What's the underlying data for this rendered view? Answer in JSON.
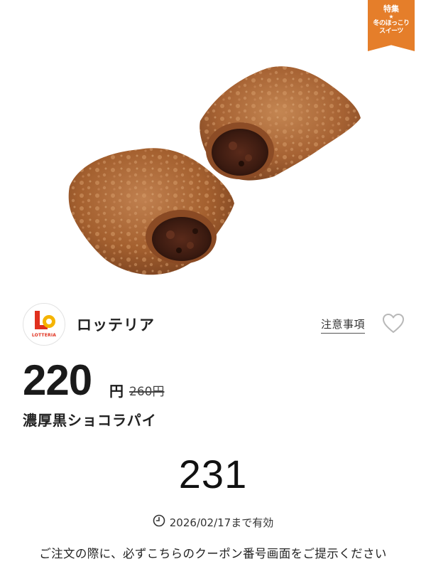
{
  "ribbon": {
    "title": "特集",
    "star": "★",
    "line1": "冬のほっこり",
    "line2": "スイーツ"
  },
  "hero": {
    "image": "chocolate-pie-photo"
  },
  "brand": {
    "logo_text": "LOTTERIA",
    "name": "ロッテリア",
    "notice_label": "注意事項",
    "favorite_icon": "heart-outline-icon"
  },
  "price": {
    "current": "220",
    "currency": "円",
    "original": "260円"
  },
  "product": {
    "name": "濃厚黒ショコラパイ"
  },
  "coupon": {
    "number": "231"
  },
  "validity": {
    "icon": "clock-icon",
    "text": "2026/02/17まで有効"
  },
  "instruction": {
    "text": "ご注文の際に、必ずこちらのクーポン番号画面をご提示ください"
  },
  "colors": {
    "accent": "#e57e2a",
    "brand_red": "#e0301e",
    "brand_yellow": "#f5b400",
    "pastry": "#a65f33"
  }
}
